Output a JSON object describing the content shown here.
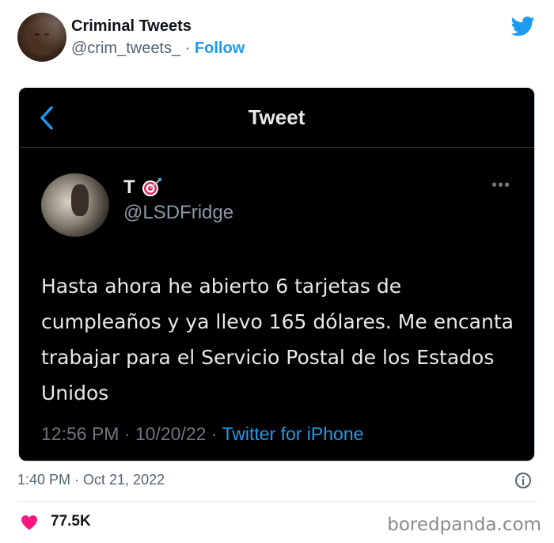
{
  "author": {
    "name": "Criminal Tweets",
    "handle": "@crim_tweets_",
    "separator": " · ",
    "follow_label": "Follow"
  },
  "card": {
    "title": "Tweet",
    "inner_author": {
      "name": "T",
      "handle": "@LSDFridge"
    },
    "more_label": "•••",
    "text": "Hasta ahora he abierto 6 tarjetas de cumpleaños y ya llevo 165 dólares. Me encanta trabajar para el Servicio Postal de los Estados Unidos",
    "timestamp": "12:56 PM · 10/20/22 · ",
    "source": "Twitter for iPhone"
  },
  "footer": {
    "timestamp": "1:40 PM · Oct 21, 2022",
    "likes": "77.5K",
    "watermark": "boredpanda.com"
  },
  "colors": {
    "accent": "#1d9bf0",
    "heart": "#f91880",
    "card_bg": "#000000"
  },
  "icons": [
    "twitter-bird-icon",
    "back-chevron-icon",
    "target-emoji-icon",
    "more-dots-icon",
    "info-icon",
    "heart-icon"
  ]
}
